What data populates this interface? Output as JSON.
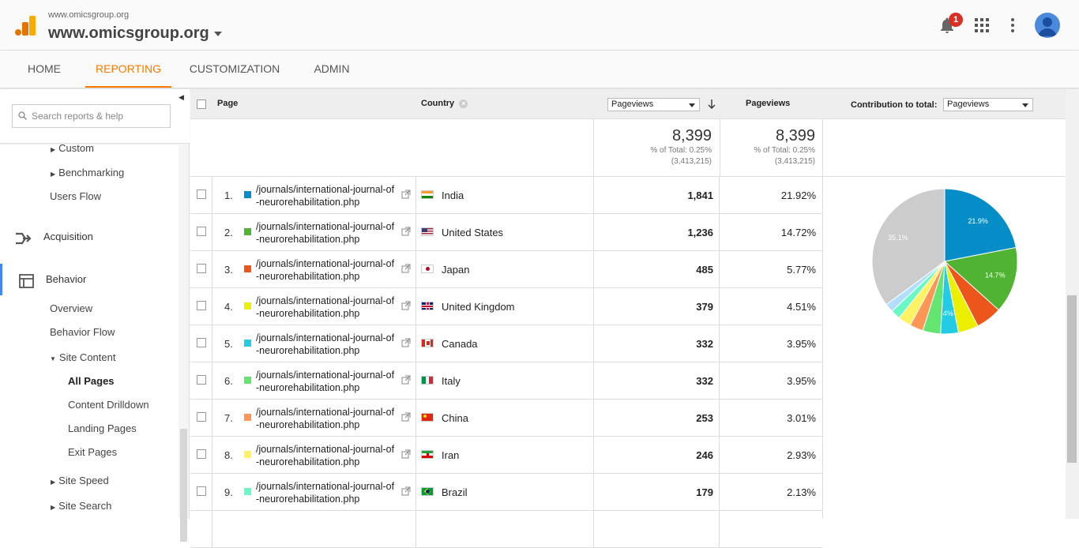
{
  "header": {
    "site_small": "www.omicsgroup.org",
    "site_big": "www.omicsgroup.org",
    "notification_count": "1",
    "logo_icon": "analytics-logo-icon",
    "icons": [
      "bell-icon",
      "apps-grid-icon",
      "more-vert-icon",
      "account-avatar-icon"
    ]
  },
  "nav": {
    "tabs": [
      {
        "label": "HOME"
      },
      {
        "label": "REPORTING"
      },
      {
        "label": "CUSTOMIZATION"
      },
      {
        "label": "ADMIN"
      }
    ],
    "active": "REPORTING",
    "accent_color": "#f57c00"
  },
  "sidebar": {
    "search_placeholder": "Search reports & help",
    "items": {
      "custom": "Custom",
      "benchmarking": "Benchmarking",
      "users_flow": "Users Flow",
      "acquisition": "Acquisition",
      "behavior": "Behavior",
      "overview": "Overview",
      "behavior_flow": "Behavior Flow",
      "site_content": "Site Content",
      "all_pages": "All Pages",
      "content_drilldown": "Content Drilldown",
      "landing_pages": "Landing Pages",
      "exit_pages": "Exit Pages",
      "site_speed": "Site Speed",
      "site_search": "Site Search"
    },
    "active_accent": "#4285f4"
  },
  "table": {
    "headers": {
      "page": "Page",
      "country": "Country",
      "metric_select": "Pageviews",
      "pageviews": "Pageviews",
      "contribution_label": "Contribution to total:",
      "contribution_select": "Pageviews"
    },
    "summary": {
      "total_a": "8,399",
      "pct_a": "% of Total: 0.25%",
      "abs_a": "(3,413,215)",
      "total_b": "8,399",
      "pct_b": "% of Total: 0.25%",
      "abs_b": "(3,413,215)"
    },
    "rows": [
      {
        "num": "1.",
        "page_l1": "/journals/international-journal-of",
        "page_l2": "-neurorehabilitation.php",
        "country": "India",
        "pageviews": "1,841",
        "pct": "21.92%",
        "color": "#058dc7"
      },
      {
        "num": "2.",
        "page_l1": "/journals/international-journal-of",
        "page_l2": "-neurorehabilitation.php",
        "country": "United States",
        "pageviews": "1,236",
        "pct": "14.72%",
        "color": "#50b432"
      },
      {
        "num": "3.",
        "page_l1": "/journals/international-journal-of",
        "page_l2": "-neurorehabilitation.php",
        "country": "Japan",
        "pageviews": "485",
        "pct": "5.77%",
        "color": "#ed561b"
      },
      {
        "num": "4.",
        "page_l1": "/journals/international-journal-of",
        "page_l2": "-neurorehabilitation.php",
        "country": "United Kingdom",
        "pageviews": "379",
        "pct": "4.51%",
        "color": "#edef00"
      },
      {
        "num": "5.",
        "page_l1": "/journals/international-journal-of",
        "page_l2": "-neurorehabilitation.php",
        "country": "Canada",
        "pageviews": "332",
        "pct": "3.95%",
        "color": "#24cbe5"
      },
      {
        "num": "6.",
        "page_l1": "/journals/international-journal-of",
        "page_l2": "-neurorehabilitation.php",
        "country": "Italy",
        "pageviews": "332",
        "pct": "3.95%",
        "color": "#64e572"
      },
      {
        "num": "7.",
        "page_l1": "/journals/international-journal-of",
        "page_l2": "-neurorehabilitation.php",
        "country": "China",
        "pageviews": "253",
        "pct": "3.01%",
        "color": "#ff9655"
      },
      {
        "num": "8.",
        "page_l1": "/journals/international-journal-of",
        "page_l2": "-neurorehabilitation.php",
        "country": "Iran",
        "pageviews": "246",
        "pct": "2.93%",
        "color": "#fff263"
      },
      {
        "num": "9.",
        "page_l1": "/journals/international-journal-of",
        "page_l2": "-neurorehabilitation.php",
        "country": "Brazil",
        "pageviews": "179",
        "pct": "2.13%",
        "color": "#6af9c4"
      }
    ]
  },
  "pie": {
    "slices": [
      {
        "value": 21.92,
        "color": "#058dc7",
        "label": "21.9%"
      },
      {
        "value": 14.72,
        "color": "#50b432",
        "label": "14.7%"
      },
      {
        "value": 5.77,
        "color": "#ed561b",
        "label": ""
      },
      {
        "value": 4.51,
        "color": "#edef00",
        "label": ""
      },
      {
        "value": 3.95,
        "color": "#24cbe5",
        "label": "4%"
      },
      {
        "value": 3.95,
        "color": "#64e572",
        "label": ""
      },
      {
        "value": 3.01,
        "color": "#ff9655",
        "label": ""
      },
      {
        "value": 2.93,
        "color": "#fff263",
        "label": ""
      },
      {
        "value": 2.13,
        "color": "#6af9c4",
        "label": ""
      },
      {
        "value": 1.9,
        "color": "#b2deff",
        "label": ""
      },
      {
        "value": 35.1,
        "color": "#cccccc",
        "label": "35.1%"
      }
    ]
  }
}
